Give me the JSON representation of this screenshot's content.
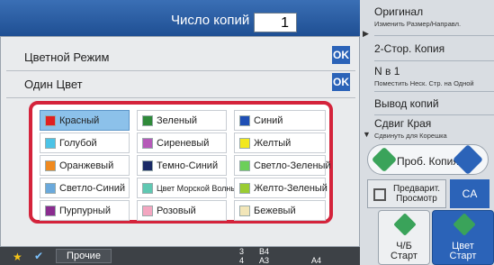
{
  "copies": {
    "label": "Число копий",
    "value": "1"
  },
  "dialog": {
    "color_mode_label": "Цветной Режим",
    "single_color_label": "Один Цвет",
    "ok_label": "OK"
  },
  "colors": [
    {
      "label": "Красный",
      "color": "#e02020"
    },
    {
      "label": "Зеленый",
      "color": "#2f8a3a"
    },
    {
      "label": "Синий",
      "color": "#1e4fb5"
    },
    {
      "label": "Голубой",
      "color": "#4cc3e6"
    },
    {
      "label": "Сиреневый",
      "color": "#b55ab8"
    },
    {
      "label": "Желтый",
      "color": "#f2e81e"
    },
    {
      "label": "Оранжевый",
      "color": "#f08a1f"
    },
    {
      "label": "Темно-Синий",
      "color": "#1a2a66"
    },
    {
      "label": "Светло-Зеленый",
      "color": "#6ccf5a"
    },
    {
      "label": "Светло-Синий",
      "color": "#6aa9dc"
    },
    {
      "label": "Цвет Морской Волны",
      "color": "#5fc8b2"
    },
    {
      "label": "Желто-Зеленый",
      "color": "#9acd32"
    },
    {
      "label": "Пурпурный",
      "color": "#8a2c8f"
    },
    {
      "label": "Розовый",
      "color": "#f3a6c0"
    },
    {
      "label": "Бежевый",
      "color": "#f2e6b8"
    }
  ],
  "selected_color": "Красный",
  "bottom": {
    "other_label": "Прочие",
    "tray": {
      "n3": "3",
      "b4": "B4",
      "n4": "4",
      "a3": "A3",
      "a4": "A4"
    }
  },
  "right_menu": {
    "original_title": "Оригинал",
    "original_sub": "Изменить Размер/Направл.",
    "duplex_title": "2-Стор. Копия",
    "nup_title": "N в 1",
    "nup_sub": "Поместить Неск. Стр. на Одной",
    "output_title": "Вывод копий",
    "shift_title": "Сдвиг Края",
    "shift_sub": "Сдвинуть для Корешка"
  },
  "actions": {
    "preview_copy": "Проб. Копия",
    "preview_line1": "Предварит.",
    "preview_line2": "Просмотр",
    "ca": "CA",
    "bw_line1": "Ч/Б",
    "bw_line2": "Старт",
    "color_line1": "Цвет",
    "color_line2": "Старт"
  }
}
